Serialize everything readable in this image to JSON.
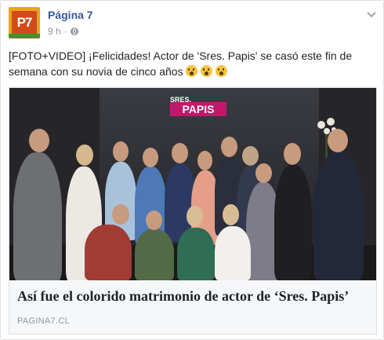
{
  "post": {
    "page_name": "Página 7",
    "avatar_text": "P7",
    "time": "9 h",
    "separator": "·",
    "privacy_icon": "globe-icon",
    "menu_icon": "chevron-down-icon",
    "text": "[FOTO+VIDEO] ¡Felicidades! Actor de 'Sres. Papis' se casó este fin de semana con su novia de cinco años",
    "emojis": [
      "😮",
      "😮",
      "😮"
    ]
  },
  "link": {
    "image_logo_top": "SRES.",
    "image_logo_main": "PAPIS",
    "title": "Así fue el colorido matrimonio de actor de ‘Sres. Papis’",
    "domain": "PAGINA7.CL"
  },
  "colors": {
    "link_blue": "#365899",
    "meta_gray": "#90949c",
    "avatar_orange": "#e8a31c",
    "logo_magenta": "#c4176b"
  }
}
